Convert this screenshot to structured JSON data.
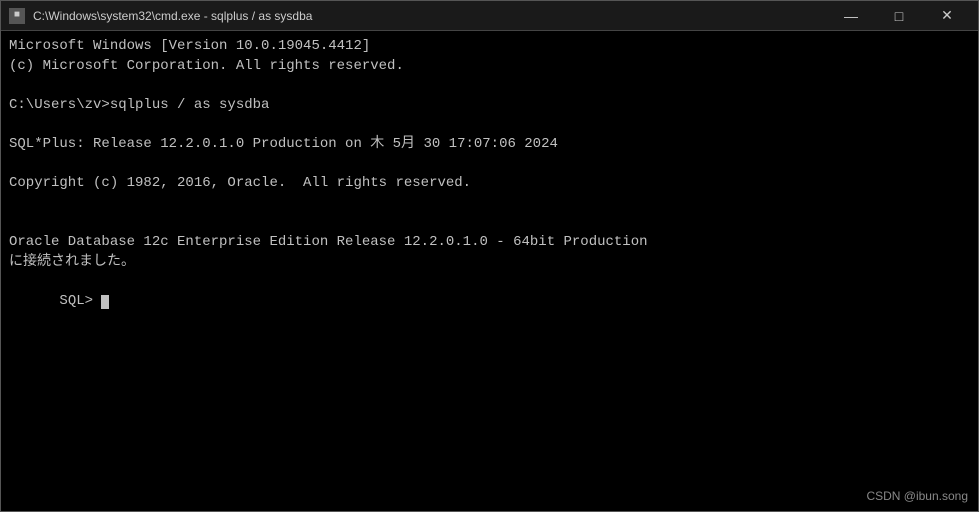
{
  "titlebar": {
    "icon": "■",
    "title": "C:\\Windows\\system32\\cmd.exe - sqlplus  / as sysdba",
    "minimize": "—",
    "maximize": "□",
    "close": "✕"
  },
  "terminal": {
    "lines": [
      "Microsoft Windows [Version 10.0.19045.4412]",
      "(c) Microsoft Corporation. All rights reserved.",
      "",
      "C:\\Users\\zv>sqlplus / as sysdba",
      "",
      "SQL*Plus: Release 12.2.0.1.0 Production on 木 5月 30 17:07:06 2024",
      "",
      "Copyright (c) 1982, 2016, Oracle.  All rights reserved.",
      "",
      "",
      "Oracle Database 12c Enterprise Edition Release 12.2.0.1.0 - 64bit Production",
      "に接続されました。",
      "SQL> "
    ]
  },
  "watermark": "CSDN @ibun.song"
}
